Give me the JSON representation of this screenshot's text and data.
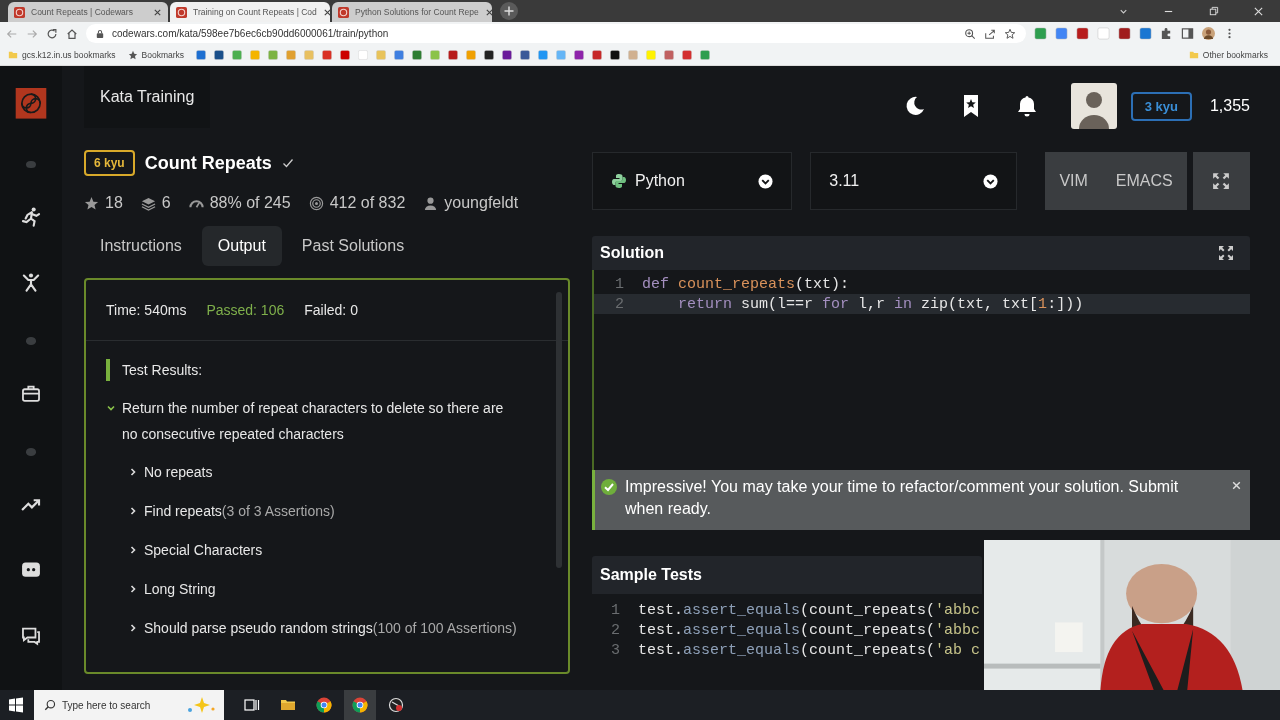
{
  "browser": {
    "tabs": [
      {
        "title": "Count Repeats | Codewars",
        "selected": false
      },
      {
        "title": "Training on Count Repeats | Cod",
        "selected": true
      },
      {
        "title": "Python Solutions for Count Repe",
        "selected": false
      }
    ],
    "address": "codewars.com/kata/598ee7b6ec6cb90dd6000061/train/python",
    "bookmark_folders": [
      "gcs.k12.in.us bookmarks",
      "Bookmarks"
    ],
    "other_bookmarks": "Other bookmarks"
  },
  "header": {
    "title": "Kata Training",
    "rank": "3 kyu",
    "honor": "1,355"
  },
  "kata": {
    "rank": "6 kyu",
    "title": "Count Repeats",
    "completed": true,
    "stats": [
      {
        "kind": "stars",
        "text": "18"
      },
      {
        "kind": "collections",
        "text": "6"
      },
      {
        "kind": "satisfaction",
        "text": "88% of 245"
      },
      {
        "kind": "completions",
        "text": "412 of 832"
      },
      {
        "kind": "author",
        "text": "youngfeldt"
      }
    ],
    "tabs": [
      {
        "label": "Instructions",
        "selected": false
      },
      {
        "label": "Output",
        "selected": true
      },
      {
        "label": "Past Solutions",
        "selected": false
      }
    ]
  },
  "output": {
    "time": "Time: 540ms",
    "passed": "Passed: 106",
    "failed": "Failed: 0",
    "heading": "Test Results:",
    "tree": [
      {
        "label": "Return the number of repeat characters to delete so there are no consecutive repeated characters",
        "expanded": true,
        "children": [
          {
            "label": "No repeats",
            "expanded": false
          },
          {
            "label": "Find repeats",
            "note": "(3 of 3 Assertions)",
            "expanded": false
          },
          {
            "label": "Special Characters",
            "expanded": false
          },
          {
            "label": "Long String",
            "expanded": false
          },
          {
            "label": "Should parse pseudo random strings",
            "note": "(100 of 100 Assertions)",
            "expanded": false
          }
        ]
      }
    ]
  },
  "editor": {
    "language": "Python",
    "version": "3.11",
    "modes": [
      "VIM",
      "EMACS"
    ],
    "solution_title": "Solution",
    "solution_lines": [
      {
        "number": "1",
        "current": false,
        "tokens": [
          {
            "kind": "keyword",
            "t": "def"
          },
          {
            "kind": "function",
            "t": " count_repeats"
          },
          {
            "kind": "plain",
            "t": "(txt):"
          }
        ]
      },
      {
        "number": "2",
        "current": true,
        "tokens": [
          {
            "kind": "keyword",
            "t": "    return"
          },
          {
            "kind": "plain",
            "t": " sum(l==r "
          },
          {
            "kind": "keyword",
            "t": "for"
          },
          {
            "kind": "plain",
            "t": " l,r "
          },
          {
            "kind": "keyword",
            "t": "in"
          },
          {
            "kind": "plain",
            "t": " zip(txt, txt["
          },
          {
            "kind": "number",
            "t": "1"
          },
          {
            "kind": "plain",
            "t": ":]))"
          }
        ]
      }
    ],
    "banner": "Impressive! You may take your time to refactor/comment your solution. Submit when ready.",
    "tests_title": "Sample Tests",
    "test_lines": [
      {
        "number": "1",
        "tokens": [
          {
            "kind": "plain",
            "t": "test."
          },
          {
            "kind": "method",
            "t": "assert_equals"
          },
          {
            "kind": "plain",
            "t": "(count_repeats("
          },
          {
            "kind": "string",
            "t": "'abbc"
          }
        ]
      },
      {
        "number": "2",
        "tokens": [
          {
            "kind": "plain",
            "t": "test."
          },
          {
            "kind": "method",
            "t": "assert_equals"
          },
          {
            "kind": "plain",
            "t": "(count_repeats("
          },
          {
            "kind": "string",
            "t": "'abbc"
          }
        ]
      },
      {
        "number": "3",
        "tokens": [
          {
            "kind": "plain",
            "t": "test."
          },
          {
            "kind": "method",
            "t": "assert_equals"
          },
          {
            "kind": "plain",
            "t": "(count_repeats("
          },
          {
            "kind": "string",
            "t": "'ab c"
          }
        ]
      }
    ]
  },
  "taskbar": {
    "search_placeholder": "Type here to search"
  }
}
